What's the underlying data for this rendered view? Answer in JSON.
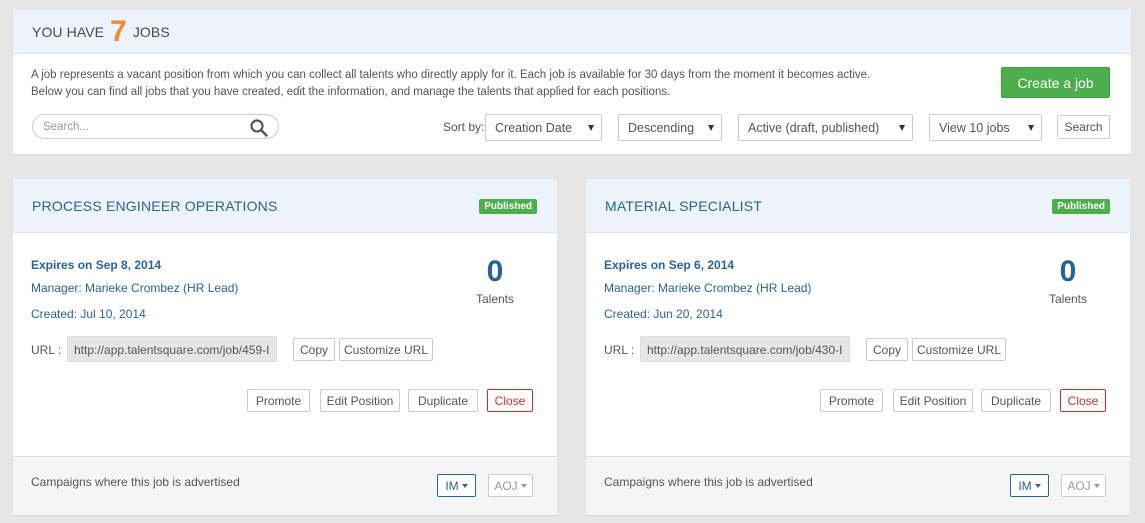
{
  "header": {
    "prefix": "YOU HAVE",
    "count": "7",
    "suffix": "JOBS"
  },
  "description": {
    "line1": "A job represents a vacant position from which you can collect all talents who directly apply for it. Each job is available for 30 days from the moment it becomes active.",
    "line2": "Below you can find all jobs that you have created, edit the information, and manage the talents that applied for each positions."
  },
  "create_button": "Create a job",
  "search": {
    "placeholder": "Search...",
    "icon": "search-icon"
  },
  "sort_label": "Sort by:",
  "filters": {
    "sort_field": "Creation Date",
    "sort_order": "Descending",
    "status": "Active (draft, published)",
    "view": "View 10 jobs"
  },
  "search_button": "Search",
  "jobs": [
    {
      "title": "PROCESS ENGINEER OPERATIONS",
      "status": "Published",
      "expires": "Expires on Sep 8, 2014",
      "manager": "Manager: Marieke Crombez (HR Lead)",
      "created": "Created: Jul 10, 2014",
      "talents_count": "0",
      "talents_label": "Talents",
      "url_label": "URL :",
      "url": "http://app.talentsquare.com/job/459-I",
      "copy": "Copy",
      "customize_url": "Customize URL",
      "promote": "Promote",
      "edit": "Edit Position",
      "duplicate": "Duplicate",
      "close": "Close",
      "campaigns": "Campaigns where this job is advertised",
      "im": "IM",
      "aoj": "AOJ"
    },
    {
      "title": "MATERIAL SPECIALIST",
      "status": "Published",
      "expires": "Expires on Sep 6, 2014",
      "manager": "Manager: Marieke Crombez (HR Lead)",
      "created": "Created: Jun 20, 2014",
      "talents_count": "0",
      "talents_label": "Talents",
      "url_label": "URL :",
      "url": "http://app.talentsquare.com/job/430-I",
      "copy": "Copy",
      "customize_url": "Customize URL",
      "promote": "Promote",
      "edit": "Edit Position",
      "duplicate": "Duplicate",
      "close": "Close",
      "campaigns": "Campaigns where this job is advertised",
      "im": "IM",
      "aoj": "AOJ"
    }
  ],
  "colors": {
    "accent_orange": "#f3892e",
    "link_blue": "#2a6496",
    "success_green": "#4cae4c",
    "danger_red": "#c9302c"
  }
}
